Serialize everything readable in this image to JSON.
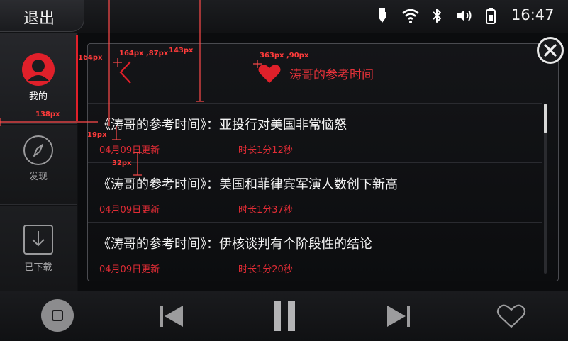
{
  "topbar": {
    "exit_label": "退出",
    "clock": "16:47",
    "icons": [
      "usb-icon",
      "wifi-icon",
      "bluetooth-icon",
      "volume-icon",
      "battery-icon"
    ]
  },
  "sidebar": {
    "items": [
      {
        "label": "我的",
        "icon": "user-avatar-icon",
        "active": true
      },
      {
        "label": "发现",
        "icon": "compass-icon",
        "active": false
      },
      {
        "label": "已下载",
        "icon": "download-icon",
        "active": false
      }
    ]
  },
  "panel": {
    "title": "涛哥的参考时间",
    "rows": [
      {
        "title": "《涛哥的参考时间》：亚投行对美国非常恼怒",
        "date": "04月09日更新",
        "duration": "时长1分12秒"
      },
      {
        "title": "《涛哥的参考时间》：美国和菲律宾军演人数创下新高",
        "date": "04月09日更新",
        "duration": "时长1分37秒"
      },
      {
        "title": "《涛哥的参考时间》：伊核谈判有个阶段性的结论",
        "date": "04月09日更新",
        "duration": "时长1分20秒"
      }
    ]
  },
  "overlay": {
    "labels": [
      "164px",
      "164px ,87px",
      "143px",
      "363px ,90px",
      "138px",
      "19px",
      "32px"
    ]
  },
  "bottombar": {
    "controls": [
      "home-button",
      "previous-button",
      "pause-button",
      "next-button",
      "like-button"
    ]
  },
  "colors": {
    "accent": "#e0202a",
    "background": "#0b0c0e"
  }
}
